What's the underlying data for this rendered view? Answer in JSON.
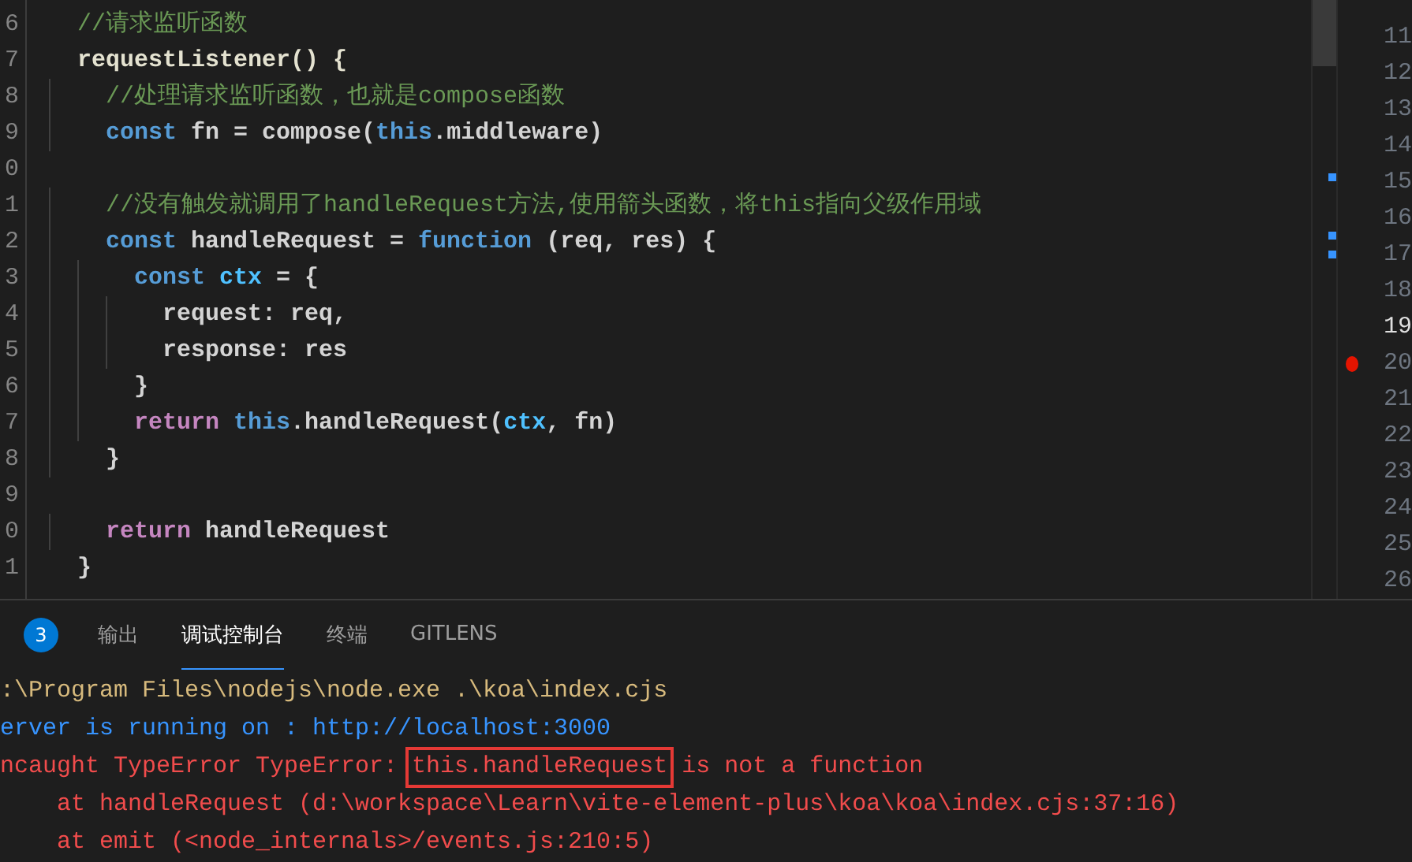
{
  "editor": {
    "line_numbers": [
      "6",
      "7",
      "8",
      "9",
      "0",
      "1",
      "2",
      "3",
      "4",
      "5",
      "6",
      "7",
      "8",
      "9",
      "0",
      "1"
    ],
    "lines": [
      {
        "kind": "code",
        "tokens": [
          {
            "kind": "comment",
            "text": "  //请求监听函数"
          }
        ]
      },
      {
        "kind": "code",
        "tokens": [
          {
            "kind": "funcname",
            "text": "  requestListener() {"
          }
        ]
      },
      {
        "kind": "code",
        "tokens": [
          {
            "kind": "comment",
            "text": "    //处理请求监听函数，也就是compose函数"
          }
        ]
      },
      {
        "kind": "code",
        "tokens": [
          {
            "kind": "keyword",
            "text": "    const "
          },
          {
            "kind": "plain",
            "text": "fn = compose("
          },
          {
            "kind": "keyword",
            "text": "this"
          },
          {
            "kind": "plain",
            "text": ".middleware)"
          }
        ]
      },
      {
        "kind": "blank"
      },
      {
        "kind": "code",
        "tokens": [
          {
            "kind": "comment",
            "text": "    //没有触发就调用了handleRequest方法,使用箭头函数，将this指向父级作用域"
          }
        ]
      },
      {
        "kind": "code",
        "tokens": [
          {
            "kind": "keyword",
            "text": "    const "
          },
          {
            "kind": "plain",
            "text": "handleRequest = "
          },
          {
            "kind": "keyword",
            "text": "function"
          },
          {
            "kind": "plain",
            "text": " (req, res) {"
          }
        ]
      },
      {
        "kind": "code",
        "tokens": [
          {
            "kind": "keyword",
            "text": "      const "
          },
          {
            "kind": "variable",
            "text": "ctx"
          },
          {
            "kind": "plain",
            "text": " = {"
          }
        ]
      },
      {
        "kind": "code",
        "tokens": [
          {
            "kind": "plain",
            "text": "        request: req,"
          }
        ]
      },
      {
        "kind": "code",
        "tokens": [
          {
            "kind": "plain",
            "text": "        response: res"
          }
        ]
      },
      {
        "kind": "code",
        "tokens": [
          {
            "kind": "plain",
            "text": "      }"
          }
        ]
      },
      {
        "kind": "code",
        "tokens": [
          {
            "kind": "control",
            "text": "      return "
          },
          {
            "kind": "keyword",
            "text": "this"
          },
          {
            "kind": "plain",
            "text": ".handleRequest("
          },
          {
            "kind": "variable",
            "text": "ctx"
          },
          {
            "kind": "plain",
            "text": ", fn)"
          }
        ]
      },
      {
        "kind": "code",
        "tokens": [
          {
            "kind": "plain",
            "text": "    }"
          }
        ]
      },
      {
        "kind": "blank"
      },
      {
        "kind": "code",
        "tokens": [
          {
            "kind": "control",
            "text": "    return "
          },
          {
            "kind": "plain",
            "text": "handleRequest"
          }
        ]
      },
      {
        "kind": "code",
        "tokens": [
          {
            "kind": "plain",
            "text": "  }"
          }
        ]
      }
    ]
  },
  "side_gutter": [
    {
      "number": "11",
      "current": false,
      "breakpoint": false
    },
    {
      "number": "12",
      "current": false,
      "breakpoint": false
    },
    {
      "number": "13",
      "current": false,
      "breakpoint": false
    },
    {
      "number": "14",
      "current": false,
      "breakpoint": false
    },
    {
      "number": "15",
      "current": false,
      "breakpoint": false
    },
    {
      "number": "16",
      "current": false,
      "breakpoint": false
    },
    {
      "number": "17",
      "current": false,
      "breakpoint": false
    },
    {
      "number": "18",
      "current": false,
      "breakpoint": false
    },
    {
      "number": "19",
      "current": true,
      "breakpoint": false
    },
    {
      "number": "20",
      "current": false,
      "breakpoint": true
    },
    {
      "number": "21",
      "current": false,
      "breakpoint": false
    },
    {
      "number": "22",
      "current": false,
      "breakpoint": false
    },
    {
      "number": "23",
      "current": false,
      "breakpoint": false
    },
    {
      "number": "24",
      "current": false,
      "breakpoint": false
    },
    {
      "number": "25",
      "current": false,
      "breakpoint": false
    },
    {
      "number": "26",
      "current": false,
      "breakpoint": false
    }
  ],
  "panel": {
    "tabs": [
      {
        "kind": "badge",
        "label": "3"
      },
      {
        "kind": "tab",
        "label": "输出",
        "selected": false
      },
      {
        "kind": "tab",
        "label": "调试控制台",
        "selected": true
      },
      {
        "kind": "tab",
        "label": "终端",
        "selected": false
      },
      {
        "kind": "tab",
        "label": "GITLENS",
        "selected": false
      }
    ],
    "console": [
      [
        {
          "kind": "command",
          "text": ":\\Program Files\\nodejs\\node.exe .\\koa\\index.cjs",
          "highlighted": false
        }
      ],
      [
        {
          "kind": "info",
          "text": "erver is running on : http://localhost:3000",
          "highlighted": false
        }
      ],
      [
        {
          "kind": "error",
          "text": "ncaught TypeError TypeError: ",
          "highlighted": false
        },
        {
          "kind": "error",
          "text": "this.handleRequest",
          "highlighted": true
        },
        {
          "kind": "error",
          "text": " is not a function",
          "highlighted": false
        }
      ],
      [
        {
          "kind": "error",
          "text": "    at handleRequest (d:\\workspace\\Learn\\vite-element-plus\\koa\\koa\\index.cjs:37:16)",
          "highlighted": false
        }
      ],
      [
        {
          "kind": "error",
          "text": "    at emit (<node_internals>/events.js:210:5)",
          "highlighted": false
        }
      ]
    ]
  }
}
